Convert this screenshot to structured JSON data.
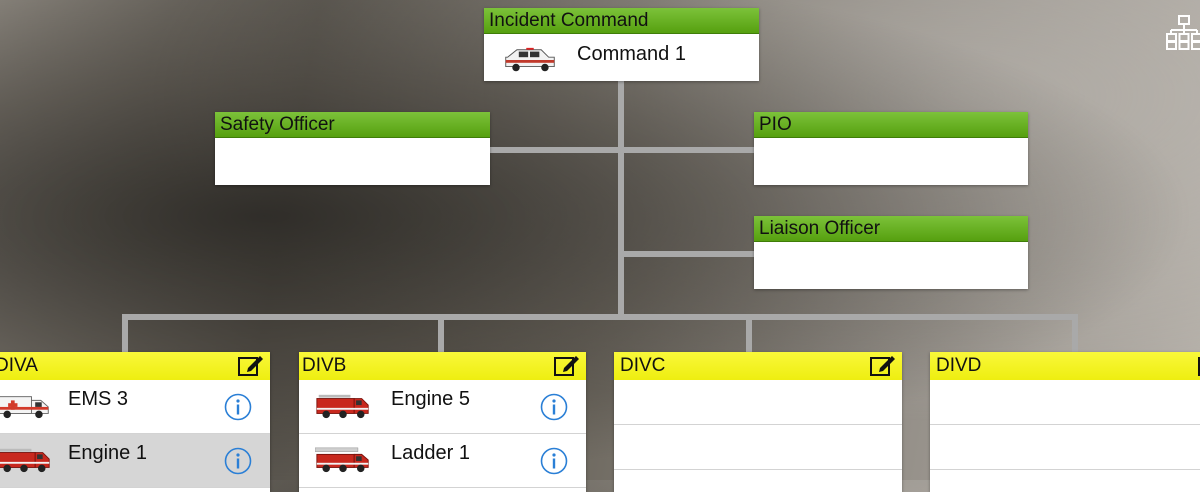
{
  "command": {
    "title": "Incident Command",
    "unit": "Command 1"
  },
  "staff": {
    "safety": "Safety Officer",
    "pio": "PIO",
    "liaison": "Liaison Officer"
  },
  "divisions": [
    {
      "name": "DIVA",
      "units": [
        {
          "label": "EMS 3",
          "vehicle": "ambulance"
        },
        {
          "label": "Engine 1",
          "vehicle": "fire-engine"
        }
      ]
    },
    {
      "name": "DIVB",
      "units": [
        {
          "label": "Engine 5",
          "vehicle": "fire-engine"
        },
        {
          "label": "Ladder 1",
          "vehicle": "ladder-truck"
        }
      ]
    },
    {
      "name": "DIVC",
      "units": []
    },
    {
      "name": "DIVD",
      "units": []
    }
  ],
  "icons": {
    "org_chart": "org-chart-icon",
    "edit": "edit-icon",
    "info": "info-icon"
  },
  "colors": {
    "header_green": "#5ea816",
    "header_yellow": "#f3f320",
    "connector": "#a9a9a9",
    "info_blue": "#2a7fd6",
    "selected_row": "#d6d6d6"
  }
}
